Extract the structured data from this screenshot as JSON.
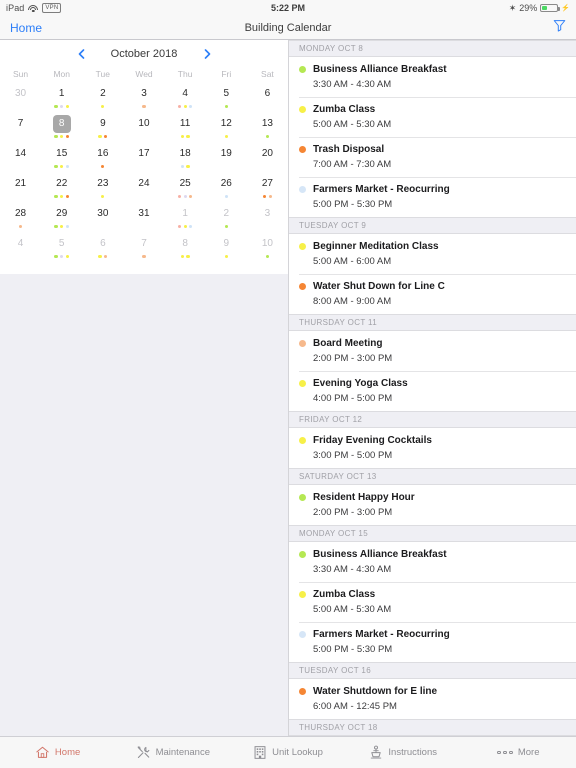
{
  "status_bar": {
    "device": "iPad",
    "wifi_icon": "wifi-icon",
    "vpn_label": "VPN",
    "time": "5:22 PM",
    "bluetooth_icon": "bluetooth-icon",
    "battery_percent": "29%",
    "battery_level": 29,
    "battery_color": "#4cd964",
    "charging_icon": "plug-icon"
  },
  "nav_bar": {
    "back_label": "Home",
    "title": "Building Calendar",
    "filter_icon": "filter-icon",
    "filter_color": "#2c7ef8"
  },
  "calendar": {
    "month_label": "October 2018",
    "prev_icon": "chevron-left-icon",
    "next_icon": "chevron-right-icon",
    "arrow_color": "#2c7ef8",
    "selected_day": 8,
    "weekday_headers": [
      "Sun",
      "Mon",
      "Tue",
      "Wed",
      "Thu",
      "Fri",
      "Sat"
    ],
    "dot_colors": {
      "green": "#b5e853",
      "yellow": "#f7f048",
      "orange": "#f58634",
      "peach": "#f6b98c",
      "blue": "#cfe3f7",
      "lilac": "#ddd8ef",
      "pink": "#f7b0a5"
    },
    "weeks": [
      [
        {
          "day": 30,
          "muted": true,
          "dots": []
        },
        {
          "day": 1,
          "muted": false,
          "dots": [
            "green",
            "lilac",
            "yellow"
          ]
        },
        {
          "day": 2,
          "muted": false,
          "dots": [
            "yellow"
          ]
        },
        {
          "day": 3,
          "muted": false,
          "dots": [
            "peach"
          ]
        },
        {
          "day": 4,
          "muted": false,
          "dots": [
            "pink",
            "yellow",
            "blue"
          ]
        },
        {
          "day": 5,
          "muted": false,
          "dots": [
            "green"
          ]
        },
        {
          "day": 6,
          "muted": false,
          "dots": []
        }
      ],
      [
        {
          "day": 7,
          "muted": false,
          "dots": []
        },
        {
          "day": 8,
          "muted": false,
          "selected": true,
          "dots": [
            "green",
            "yellow",
            "orange"
          ]
        },
        {
          "day": 9,
          "muted": false,
          "dots": [
            "yellow",
            "orange"
          ]
        },
        {
          "day": 10,
          "muted": false,
          "dots": []
        },
        {
          "day": 11,
          "muted": false,
          "dots": [
            "yellow",
            "yellow"
          ]
        },
        {
          "day": 12,
          "muted": false,
          "dots": [
            "yellow"
          ]
        },
        {
          "day": 13,
          "muted": false,
          "dots": [
            "green"
          ]
        }
      ],
      [
        {
          "day": 14,
          "muted": false,
          "dots": []
        },
        {
          "day": 15,
          "muted": false,
          "dots": [
            "green",
            "yellow",
            "blue"
          ]
        },
        {
          "day": 16,
          "muted": false,
          "dots": [
            "orange"
          ]
        },
        {
          "day": 17,
          "muted": false,
          "dots": []
        },
        {
          "day": 18,
          "muted": false,
          "dots": [
            "blue",
            "yellow"
          ]
        },
        {
          "day": 19,
          "muted": false,
          "dots": []
        },
        {
          "day": 20,
          "muted": false,
          "dots": []
        }
      ],
      [
        {
          "day": 21,
          "muted": false,
          "dots": []
        },
        {
          "day": 22,
          "muted": false,
          "dots": [
            "green",
            "yellow",
            "orange"
          ]
        },
        {
          "day": 23,
          "muted": false,
          "dots": [
            "yellow"
          ]
        },
        {
          "day": 24,
          "muted": false,
          "dots": []
        },
        {
          "day": 25,
          "muted": false,
          "dots": [
            "pink",
            "lilac",
            "peach"
          ]
        },
        {
          "day": 26,
          "muted": false,
          "dots": [
            "blue"
          ]
        },
        {
          "day": 27,
          "muted": false,
          "dots": [
            "orange",
            "peach"
          ]
        }
      ],
      [
        {
          "day": 28,
          "muted": false,
          "dots": [
            "peach"
          ]
        },
        {
          "day": 29,
          "muted": false,
          "dots": [
            "green",
            "yellow",
            "blue"
          ]
        },
        {
          "day": 30,
          "muted": false,
          "dots": []
        },
        {
          "day": 31,
          "muted": false,
          "dots": []
        },
        {
          "day": 1,
          "muted": true,
          "dots": [
            "pink",
            "yellow",
            "blue"
          ]
        },
        {
          "day": 2,
          "muted": true,
          "dots": [
            "green"
          ]
        },
        {
          "day": 3,
          "muted": true,
          "dots": []
        }
      ],
      [
        {
          "day": 4,
          "muted": true,
          "dots": []
        },
        {
          "day": 5,
          "muted": true,
          "dots": [
            "green",
            "lilac",
            "yellow"
          ]
        },
        {
          "day": 6,
          "muted": true,
          "dots": [
            "yellow",
            "peach"
          ]
        },
        {
          "day": 7,
          "muted": true,
          "dots": [
            "peach"
          ]
        },
        {
          "day": 8,
          "muted": true,
          "dots": [
            "yellow",
            "yellow"
          ]
        },
        {
          "day": 9,
          "muted": true,
          "dots": [
            "yellow"
          ]
        },
        {
          "day": 10,
          "muted": true,
          "dots": [
            "green"
          ]
        }
      ]
    ]
  },
  "events": {
    "sections": [
      {
        "header": "MONDAY OCT 8",
        "items": [
          {
            "title": "Business Alliance Breakfast",
            "time": "3:30 AM - 4:30 AM",
            "color": "#b5e853"
          },
          {
            "title": "Zumba Class",
            "time": "5:00 AM - 5:30 AM",
            "color": "#f7f048"
          },
          {
            "title": "Trash Disposal",
            "time": "7:00 AM - 7:30 AM",
            "color": "#f58634"
          },
          {
            "title": "Farmers Market - Reocurring",
            "time": "5:00 PM - 5:30 PM",
            "color": "#d6e6f7"
          }
        ]
      },
      {
        "header": "TUESDAY OCT 9",
        "items": [
          {
            "title": "Beginner Meditation Class",
            "time": "5:00 AM - 6:00 AM",
            "color": "#f7f048"
          },
          {
            "title": "Water Shut Down for Line C",
            "time": "8:00 AM - 9:00 AM",
            "color": "#f58634"
          }
        ]
      },
      {
        "header": "THURSDAY OCT 11",
        "items": [
          {
            "title": "Board Meeting",
            "time": "2:00 PM - 3:00 PM",
            "color": "#f6b98c"
          },
          {
            "title": "Evening Yoga Class",
            "time": "4:00 PM - 5:00 PM",
            "color": "#f7f048"
          }
        ]
      },
      {
        "header": "FRIDAY OCT 12",
        "items": [
          {
            "title": "Friday Evening Cocktails",
            "time": "3:00 PM - 5:00 PM",
            "color": "#f7f048"
          }
        ]
      },
      {
        "header": "SATURDAY OCT 13",
        "items": [
          {
            "title": "Resident Happy Hour",
            "time": "2:00 PM - 3:00 PM",
            "color": "#b5e853"
          }
        ]
      },
      {
        "header": "MONDAY OCT 15",
        "items": [
          {
            "title": "Business Alliance Breakfast",
            "time": "3:30 AM - 4:30 AM",
            "color": "#b5e853"
          },
          {
            "title": "Zumba Class",
            "time": "5:00 AM - 5:30 AM",
            "color": "#f7f048"
          },
          {
            "title": "Farmers Market - Reocurring",
            "time": "5:00 PM - 5:30 PM",
            "color": "#d6e6f7"
          }
        ]
      },
      {
        "header": "TUESDAY OCT 16",
        "items": [
          {
            "title": "Water Shutdown for E line",
            "time": "6:00 AM - 12:45 PM",
            "color": "#f58634"
          }
        ]
      },
      {
        "header": "THURSDAY OCT 18",
        "items": []
      }
    ]
  },
  "tab_bar": {
    "active_color": "#d2776b",
    "inactive_color": "#8e8e93",
    "tabs": [
      {
        "label": "Home",
        "icon": "home-icon",
        "active": true
      },
      {
        "label": "Maintenance",
        "icon": "tools-icon",
        "active": false
      },
      {
        "label": "Unit Lookup",
        "icon": "building-icon",
        "active": false
      },
      {
        "label": "Instructions",
        "icon": "lectern-icon",
        "active": false
      },
      {
        "label": "More",
        "icon": "ellipsis-icon",
        "active": false
      }
    ]
  }
}
